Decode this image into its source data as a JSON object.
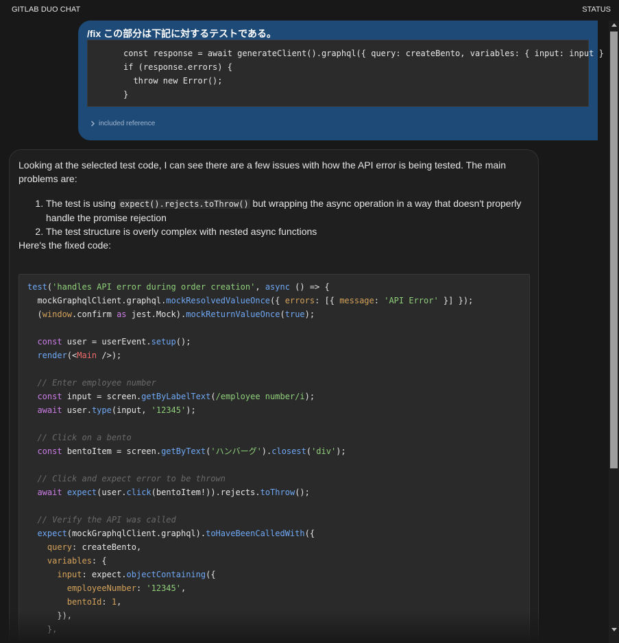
{
  "header": {
    "title": "GITLAB DUO CHAT",
    "status": "STATUS"
  },
  "user_message": {
    "command": "/fix この部分は下記に対するテストである。",
    "code": "const response = await generateClient().graphql({ query: createBento, variables: { input: input } });\nif (response.errors) {\n  throw new Error();\n}",
    "reference_label": "included reference",
    "bubble_color": "#1e4a78"
  },
  "assistant_message": {
    "intro": "Looking at the selected test code, I can see there are a few issues with how the API error is being tested. The main problems are:",
    "issue1_prefix": "The test is using ",
    "issue1_code": "expect().rejects.toThrow()",
    "issue1_suffix": " but wrapping the async operation in a way that doesn't properly handle the promise rejection",
    "issue2": "The test structure is overly complex with nested async functions",
    "fixed_label": "Here's the fixed code:",
    "code_lines": [
      [
        [
          "f",
          "test"
        ],
        [
          "p",
          "("
        ],
        [
          "s",
          "'handles API error during order creation'"
        ],
        [
          "p",
          ", "
        ],
        [
          "f",
          "async"
        ],
        [
          "p",
          " () => {"
        ]
      ],
      [
        [
          "p",
          "  mockGraphqlClient.graphql."
        ],
        [
          "f",
          "mockResolvedValueOnce"
        ],
        [
          "p",
          "({ "
        ],
        [
          "n",
          "errors"
        ],
        [
          "p",
          ": [{ "
        ],
        [
          "n",
          "message"
        ],
        [
          "p",
          ": "
        ],
        [
          "s",
          "'API Error'"
        ],
        [
          "p",
          " }] });"
        ]
      ],
      [
        [
          "p",
          "  ("
        ],
        [
          "n",
          "window"
        ],
        [
          "p",
          ".confirm "
        ],
        [
          "k",
          "as"
        ],
        [
          "p",
          " jest.Mock)."
        ],
        [
          "f",
          "mockReturnValueOnce"
        ],
        [
          "p",
          "("
        ],
        [
          "f",
          "true"
        ],
        [
          "p",
          ");"
        ]
      ],
      [],
      [
        [
          "k",
          "  const"
        ],
        [
          "p",
          " user = userEvent."
        ],
        [
          "f",
          "setup"
        ],
        [
          "p",
          "();"
        ]
      ],
      [
        [
          "f",
          "  render"
        ],
        [
          "p",
          "(<"
        ],
        [
          "t",
          "Main"
        ],
        [
          "p",
          " />);"
        ]
      ],
      [],
      [
        [
          "c",
          "  // Enter employee number"
        ]
      ],
      [
        [
          "k",
          "  const"
        ],
        [
          "p",
          " input = screen."
        ],
        [
          "f",
          "getByLabelText"
        ],
        [
          "p",
          "("
        ],
        [
          "s",
          "/employee number/i"
        ],
        [
          "p",
          ");"
        ]
      ],
      [
        [
          "k",
          "  await"
        ],
        [
          "p",
          " user."
        ],
        [
          "f",
          "type"
        ],
        [
          "p",
          "(input, "
        ],
        [
          "s",
          "'12345'"
        ],
        [
          "p",
          ");"
        ]
      ],
      [],
      [
        [
          "c",
          "  // Click on a bento"
        ]
      ],
      [
        [
          "k",
          "  const"
        ],
        [
          "p",
          " bentoItem = screen."
        ],
        [
          "f",
          "getByText"
        ],
        [
          "p",
          "("
        ],
        [
          "s",
          "'ハンバーグ'"
        ],
        [
          "p",
          ")."
        ],
        [
          "f",
          "closest"
        ],
        [
          "p",
          "("
        ],
        [
          "s",
          "'div'"
        ],
        [
          "p",
          ");"
        ]
      ],
      [],
      [
        [
          "c",
          "  // Click and expect error to be thrown"
        ]
      ],
      [
        [
          "k",
          "  await"
        ],
        [
          "p",
          " "
        ],
        [
          "f",
          "expect"
        ],
        [
          "p",
          "(user."
        ],
        [
          "f",
          "click"
        ],
        [
          "p",
          "(bentoItem!)).rejects."
        ],
        [
          "f",
          "toThrow"
        ],
        [
          "p",
          "();"
        ]
      ],
      [],
      [
        [
          "c",
          "  // Verify the API was called"
        ]
      ],
      [
        [
          "f",
          "  expect"
        ],
        [
          "p",
          "(mockGraphqlClient.graphql)."
        ],
        [
          "f",
          "toHaveBeenCalledWith"
        ],
        [
          "p",
          "({"
        ]
      ],
      [
        [
          "n",
          "    query"
        ],
        [
          "p",
          ": createBento,"
        ]
      ],
      [
        [
          "n",
          "    variables"
        ],
        [
          "p",
          ": {"
        ]
      ],
      [
        [
          "n",
          "      input"
        ],
        [
          "p",
          ": expect."
        ],
        [
          "f",
          "objectContaining"
        ],
        [
          "p",
          "({"
        ]
      ],
      [
        [
          "n",
          "        employeeNumber"
        ],
        [
          "p",
          ": "
        ],
        [
          "s",
          "'12345'"
        ],
        [
          "p",
          ","
        ]
      ],
      [
        [
          "n",
          "        bentoId"
        ],
        [
          "p",
          ": "
        ],
        [
          "n",
          "1"
        ],
        [
          "p",
          ","
        ]
      ],
      [
        [
          "p",
          "      }),"
        ]
      ],
      [
        [
          "p",
          "    },"
        ]
      ]
    ]
  }
}
